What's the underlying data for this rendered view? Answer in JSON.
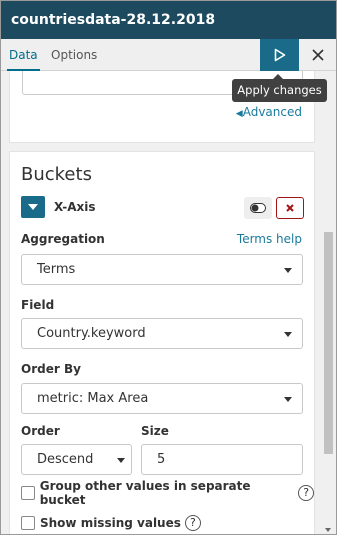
{
  "header": {
    "title": "countriesdata-28.12.2018"
  },
  "tabs": [
    {
      "label": "Data",
      "active": true
    },
    {
      "label": "Options",
      "active": false
    }
  ],
  "toolbar": {
    "apply_icon": "play-icon",
    "close_icon": "close-icon",
    "tooltip": "Apply changes"
  },
  "metrics_panel": {
    "advanced_link": "Advanced"
  },
  "buckets": {
    "title": "Buckets",
    "axis_label": "X-Axis",
    "aggregation": {
      "label": "Aggregation",
      "help": "Terms help",
      "value": "Terms"
    },
    "field": {
      "label": "Field",
      "value": "Country.keyword"
    },
    "order_by": {
      "label": "Order By",
      "value": "metric: Max Area"
    },
    "order": {
      "label": "Order",
      "value": "Descend"
    },
    "size": {
      "label": "Size",
      "value": "5"
    },
    "group_other": {
      "label": "Group other values in separate bucket",
      "checked": false
    },
    "show_missing": {
      "label": "Show missing values",
      "checked": false
    }
  },
  "colors": {
    "header": "#1d4a5f",
    "accent": "#1a6b8a",
    "link": "#1a7a9c",
    "danger": "#a31515"
  }
}
